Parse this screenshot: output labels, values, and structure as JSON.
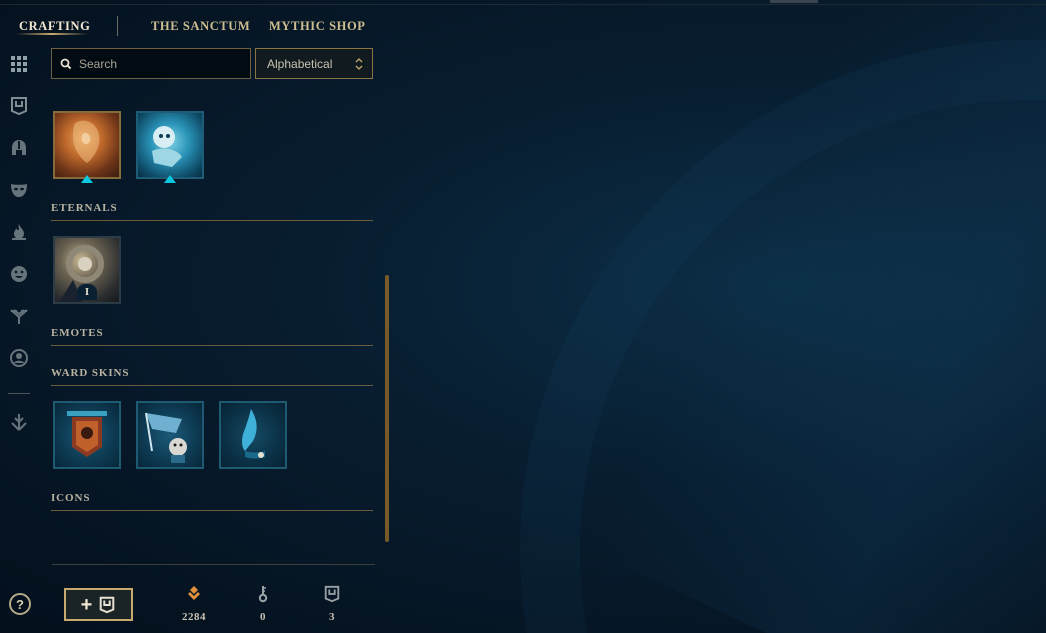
{
  "nav": {
    "tabs": [
      {
        "label": "CRAFTING",
        "active": true
      },
      {
        "label": "THE SANCTUM",
        "active": false
      },
      {
        "label": "MYTHIC SHOP",
        "active": false
      }
    ]
  },
  "sidebar": {
    "items": [
      {
        "icon": "grid-icon"
      },
      {
        "icon": "chest-icon"
      },
      {
        "icon": "helmet-icon"
      },
      {
        "icon": "mask-icon"
      },
      {
        "icon": "flame-icon"
      },
      {
        "icon": "emote-face-icon"
      },
      {
        "icon": "ward-icon"
      },
      {
        "icon": "profile-icon"
      },
      {
        "icon": "arrow-down-icon"
      }
    ],
    "help_label": "?"
  },
  "search": {
    "placeholder": "Search",
    "value": ""
  },
  "sort": {
    "selected": "Alphabetical"
  },
  "sections": {
    "eternals": "ETERNALS",
    "emotes": "EMOTES",
    "ward_skins": "WARD SKINS",
    "icons": "ICONS"
  },
  "eternal_badge": "I",
  "footer": {
    "currencies": [
      {
        "name": "orange-essence",
        "value": "2284"
      },
      {
        "name": "key",
        "value": "0"
      },
      {
        "name": "chest",
        "value": "3"
      }
    ]
  },
  "colors": {
    "gold": "#c8aa6e",
    "accent_cyan": "#0ac8e0",
    "orange_essence": "#e08f3a"
  }
}
